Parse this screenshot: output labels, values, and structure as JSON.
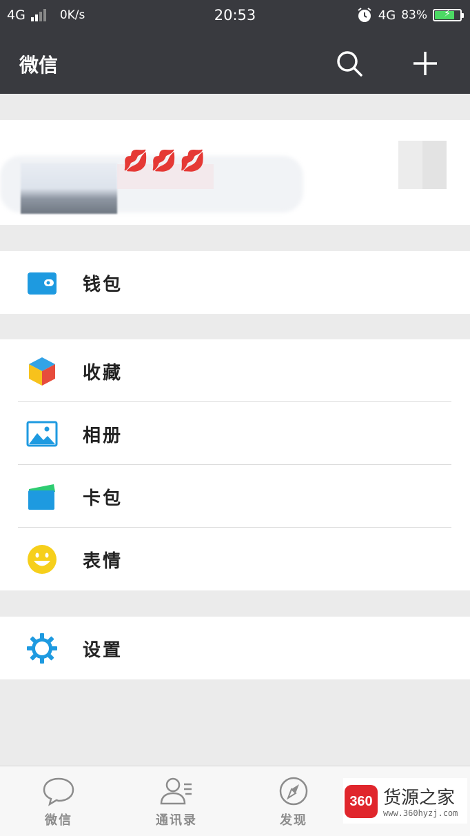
{
  "status_bar": {
    "network_left": "4G",
    "speed": "0K/s",
    "time": "20:53",
    "network_right": "4G",
    "battery_percent": "83%",
    "battery_level": 0.83,
    "battery_color": "#4cd964"
  },
  "header": {
    "title": "微信",
    "search_icon": "search-icon",
    "add_icon": "plus-icon"
  },
  "profile": {
    "decor": "💋💋💋"
  },
  "menu": {
    "wallet": {
      "label": "钱包",
      "icon": "wallet-icon",
      "color": "#1e9ae0"
    },
    "favorites": {
      "label": "收藏",
      "icon": "cube-icon"
    },
    "album": {
      "label": "相册",
      "icon": "picture-icon",
      "color": "#1e9ae0"
    },
    "cards": {
      "label": "卡包",
      "icon": "card-wallet-icon"
    },
    "stickers": {
      "label": "表情",
      "icon": "smiley-icon",
      "color": "#f6cf1b"
    },
    "settings": {
      "label": "设置",
      "icon": "gear-icon",
      "color": "#1e9ae0"
    }
  },
  "tabs": [
    {
      "label": "微信",
      "icon": "chat-bubble-icon"
    },
    {
      "label": "通讯录",
      "icon": "contacts-icon"
    },
    {
      "label": "发现",
      "icon": "compass-icon"
    }
  ],
  "watermark": {
    "logo": "360",
    "name": "货源之家",
    "url": "www.360hyzj.com"
  }
}
